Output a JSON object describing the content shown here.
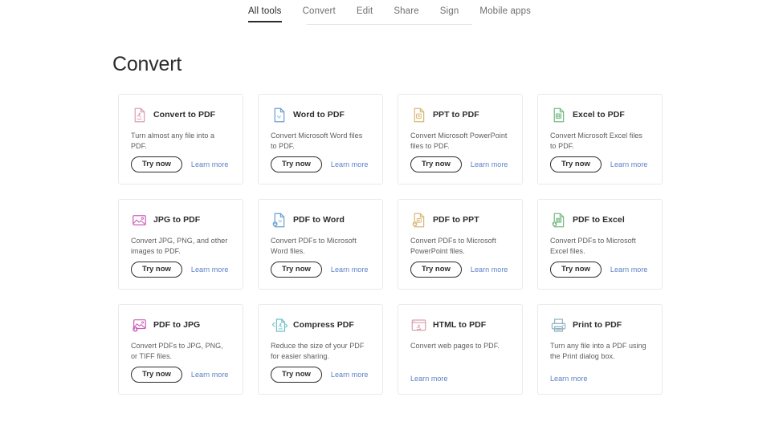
{
  "nav": {
    "items": [
      {
        "label": "All tools",
        "active": true
      },
      {
        "label": "Convert",
        "active": false
      },
      {
        "label": "Edit",
        "active": false
      },
      {
        "label": "Share",
        "active": false
      },
      {
        "label": "Sign",
        "active": false
      },
      {
        "label": "Mobile apps",
        "active": false
      }
    ]
  },
  "page": {
    "title": "Convert"
  },
  "labels": {
    "try_now": "Try now",
    "learn_more": "Learn more"
  },
  "colors": {
    "pdf_red": "#d9a0ae",
    "word_blue": "#6b9fd4",
    "ppt_orange": "#d9b877",
    "excel_green": "#79ba86",
    "jpg_magenta": "#cc5fb8",
    "compress_teal": "#6fc0c9",
    "print_gray": "#8fb3c2",
    "link_blue": "#5b7fc7",
    "text_dark": "#2c2c2c"
  },
  "cards": [
    {
      "id": "convert-to-pdf",
      "icon": "pdf-document-icon",
      "icon_color": "#d9a0ae",
      "title": "Convert to PDF",
      "description": "Turn almost any file into a PDF.",
      "has_try_now": true,
      "has_learn_more": true
    },
    {
      "id": "word-to-pdf",
      "icon": "word-document-icon",
      "icon_color": "#6b9fd4",
      "title": "Word to PDF",
      "description": "Convert Microsoft Word files to PDF.",
      "has_try_now": true,
      "has_learn_more": true
    },
    {
      "id": "ppt-to-pdf",
      "icon": "powerpoint-document-icon",
      "icon_color": "#d9b877",
      "title": "PPT to PDF",
      "description": "Convert Microsoft PowerPoint files to PDF.",
      "has_try_now": true,
      "has_learn_more": true
    },
    {
      "id": "excel-to-pdf",
      "icon": "excel-document-icon",
      "icon_color": "#79ba86",
      "title": "Excel to PDF",
      "description": "Convert Microsoft Excel files to PDF.",
      "has_try_now": true,
      "has_learn_more": true
    },
    {
      "id": "jpg-to-pdf",
      "icon": "image-icon",
      "icon_color": "#cc5fb8",
      "title": "JPG to PDF",
      "description": "Convert JPG, PNG, and other images to PDF.",
      "has_try_now": true,
      "has_learn_more": true
    },
    {
      "id": "pdf-to-word",
      "icon": "word-document-download-icon",
      "icon_color": "#6b9fd4",
      "title": "PDF to Word",
      "description": "Convert PDFs to Microsoft Word files.",
      "has_try_now": true,
      "has_learn_more": true
    },
    {
      "id": "pdf-to-ppt",
      "icon": "powerpoint-document-download-icon",
      "icon_color": "#d9b877",
      "title": "PDF to PPT",
      "description": "Convert PDFs to Microsoft PowerPoint files.",
      "has_try_now": true,
      "has_learn_more": true
    },
    {
      "id": "pdf-to-excel",
      "icon": "excel-document-download-icon",
      "icon_color": "#79ba86",
      "title": "PDF to Excel",
      "description": "Convert PDFs to Microsoft Excel files.",
      "has_try_now": true,
      "has_learn_more": true
    },
    {
      "id": "pdf-to-jpg",
      "icon": "image-download-icon",
      "icon_color": "#cc5fb8",
      "title": "PDF to JPG",
      "description": "Convert PDFs to JPG, PNG, or TIFF files.",
      "has_try_now": true,
      "has_learn_more": true
    },
    {
      "id": "compress-pdf",
      "icon": "compress-pdf-icon",
      "icon_color": "#6fc0c9",
      "title": "Compress PDF",
      "description": "Reduce the size of your PDF for easier sharing.",
      "has_try_now": true,
      "has_learn_more": true
    },
    {
      "id": "html-to-pdf",
      "icon": "browser-pdf-icon",
      "icon_color": "#d9a0ae",
      "title": "HTML to PDF",
      "description": "Convert web pages to PDF.",
      "has_try_now": false,
      "has_learn_more": true
    },
    {
      "id": "print-to-pdf",
      "icon": "printer-icon",
      "icon_color": "#8fb3c2",
      "title": "Print to PDF",
      "description": "Turn any file into a PDF using the Print dialog box.",
      "has_try_now": false,
      "has_learn_more": true
    }
  ]
}
